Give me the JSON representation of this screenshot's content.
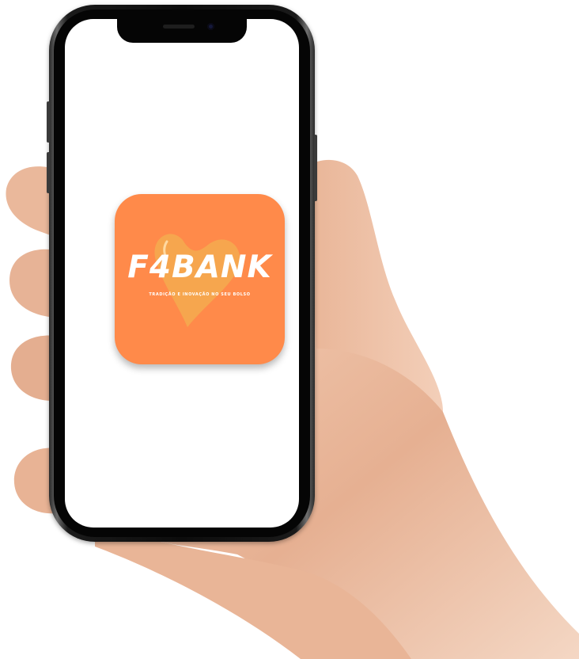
{
  "app": {
    "name": "F4BANK",
    "tagline": "TRADIÇÃO E INOVAÇÃO NO SEU BOLSO"
  },
  "colors": {
    "icon_background": "#ff8a4a",
    "heart": "#f6a84e",
    "screen": "#ffffff",
    "phone_frame": "#0c0c0c",
    "skin": "#e8b79a"
  },
  "icons": {
    "logo_mark": "heart-icon"
  }
}
